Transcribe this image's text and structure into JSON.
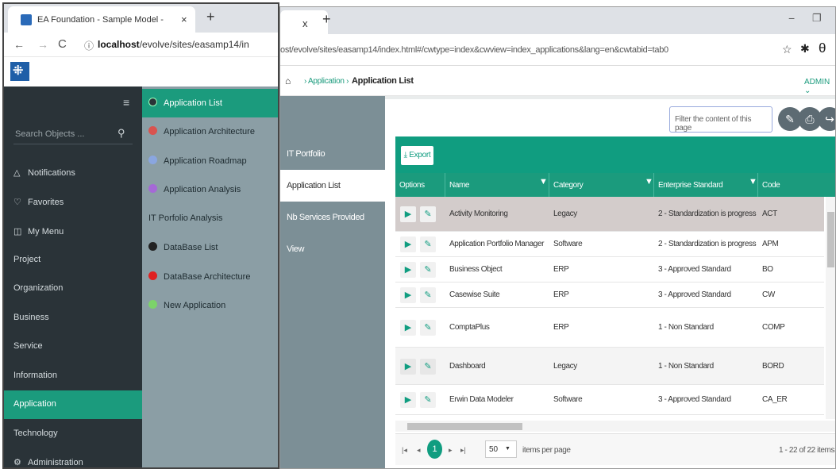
{
  "left_window": {
    "tab_title": "EA Foundation - Sample Model -",
    "tab_close": "×",
    "new_tab": "+",
    "nav": {
      "back": "←",
      "forward": "→",
      "reload": "C",
      "info": "ⓘ"
    },
    "url_host": "localhost",
    "url_path": "/evolve/sites/easamp14/in",
    "logo_glyph": "⁜",
    "sidebar": {
      "menu_icon": "≡",
      "search_placeholder": "Search Objects ...",
      "search_icon": "🔍",
      "items": [
        {
          "label": "Notifications",
          "icon": "△",
          "icon_name": "bell-icon"
        },
        {
          "label": "Favorites",
          "icon": "♡",
          "icon_name": "heart-icon"
        },
        {
          "label": "My Menu",
          "icon": "◫",
          "icon_name": "bookmark-icon"
        },
        {
          "label": "Project"
        },
        {
          "label": "Organization"
        },
        {
          "label": "Business"
        },
        {
          "label": "Service"
        },
        {
          "label": "Information"
        },
        {
          "label": "Application",
          "active": true
        },
        {
          "label": "Technology"
        },
        {
          "label": "Administration",
          "icon": "⚙",
          "icon_name": "gear-icon"
        }
      ]
    },
    "submenu": {
      "items": [
        {
          "label": "Application List",
          "icon_color": "#2a3338",
          "active": true
        },
        {
          "label": "Application Architecture",
          "icon_color": "#d9534f"
        },
        {
          "label": "Application Roadmap",
          "icon_color": "#8aa6e0"
        },
        {
          "label": "Application Analysis",
          "icon_color": "#a569d6"
        },
        {
          "label": "IT Porfolio Analysis"
        },
        {
          "label": "DataBase List",
          "icon_color": "#222222"
        },
        {
          "label": "DataBase Architecture",
          "icon_color": "#e02020"
        },
        {
          "label": "New Application",
          "icon_color": "#7cd36a"
        }
      ]
    }
  },
  "right_window": {
    "tab_close": "x",
    "new_tab": "+",
    "window_controls": {
      "minimize": "−",
      "restore": "❐"
    },
    "url": "ost/evolve/sites/easamp14/index.html#/cwtype=index&cwview=index_applications&lang=en&cwtabid=tab0",
    "toolbar_icons": {
      "star": "☆",
      "extension": "✱",
      "profile": "θ"
    },
    "breadcrumb": {
      "home": "⌂",
      "sep": "›",
      "parent": "Application",
      "current": "Application List"
    },
    "user": "ADMIN ⌄",
    "side_tabs": [
      {
        "label": "IT Portfolio"
      },
      {
        "label": "Application List",
        "active": true
      },
      {
        "label": "Nb Services Provided"
      },
      {
        "label": "View"
      }
    ],
    "filter_placeholder": "Filter the content of this page",
    "action_buttons": [
      {
        "icon": "✎",
        "name": "edit-icon"
      },
      {
        "icon": "⎙",
        "name": "print-icon"
      },
      {
        "icon": "↪",
        "name": "share-icon"
      }
    ],
    "export_label": "⤓ Export",
    "grid": {
      "columns": [
        "Options",
        "Name",
        "Category",
        "Enterprise Standard",
        "Code"
      ],
      "filter_icon": "▼",
      "rows": [
        {
          "name": "Activity Monitoring",
          "category": "Legacy",
          "standard": "2 - Standardization is progress",
          "code": "ACT"
        },
        {
          "name": "Application Portfolio Manager",
          "category": "Software",
          "standard": "2 - Standardization is progress",
          "code": "APM"
        },
        {
          "name": "Business Object",
          "category": "ERP",
          "standard": "3 - Approved Standard",
          "code": "BO"
        },
        {
          "name": "Casewise Suite",
          "category": "ERP",
          "standard": "3 - Approved Standard",
          "code": "CW"
        },
        {
          "name": "ComptaPlus",
          "category": "ERP",
          "standard": "1 - Non Standard",
          "code": "COMP"
        },
        {
          "name": "Dashboard",
          "category": "Legacy",
          "standard": "1 - Non Standard",
          "code": "BORD"
        },
        {
          "name": "Erwin Data Modeler",
          "category": "Software",
          "standard": "3 - Approved Standard",
          "code": "CA_ER"
        }
      ],
      "option_icons": {
        "open": "▶",
        "edit": "✎"
      }
    },
    "pager": {
      "first": "|◂",
      "prev": "◂",
      "current_page": "1",
      "next": "▸",
      "last": "▸|",
      "page_size": "50",
      "page_size_arrow": "▼",
      "page_size_label": "items per page",
      "count_label": "1 - 22 of 22 items"
    }
  }
}
